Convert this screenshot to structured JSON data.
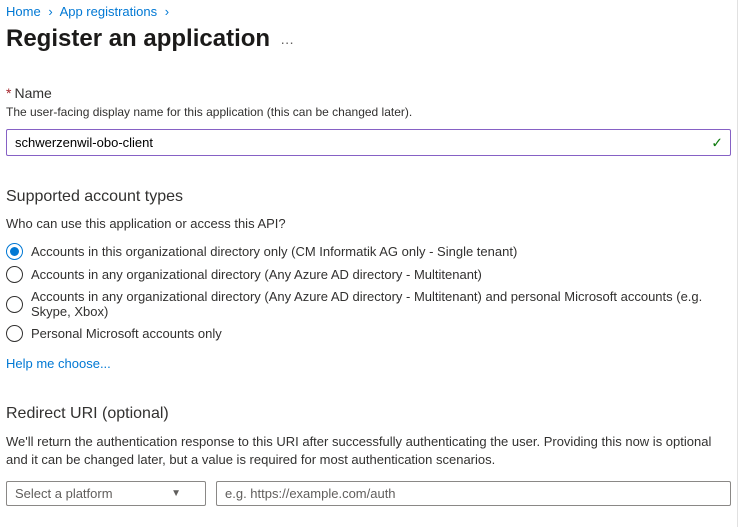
{
  "breadcrumb": {
    "items": [
      "Home",
      "App registrations"
    ]
  },
  "page": {
    "title": "Register an application"
  },
  "name_field": {
    "required_mark": "*",
    "label": "Name",
    "help": "The user-facing display name for this application (this can be changed later).",
    "value": "schwerzenwil-obo-client"
  },
  "account_types": {
    "heading": "Supported account types",
    "sub": "Who can use this application or access this API?",
    "options": [
      "Accounts in this organizational directory only (CM Informatik AG only - Single tenant)",
      "Accounts in any organizational directory (Any Azure AD directory - Multitenant)",
      "Accounts in any organizational directory (Any Azure AD directory - Multitenant) and personal Microsoft accounts (e.g. Skype, Xbox)",
      "Personal Microsoft accounts only"
    ],
    "selected_index": 0,
    "help_link": "Help me choose..."
  },
  "redirect": {
    "heading": "Redirect URI (optional)",
    "desc": "We'll return the authentication response to this URI after successfully authenticating the user. Providing this now is optional and it can be changed later, but a value is required for most authentication scenarios.",
    "platform_placeholder": "Select a platform",
    "uri_placeholder": "e.g. https://example.com/auth"
  }
}
